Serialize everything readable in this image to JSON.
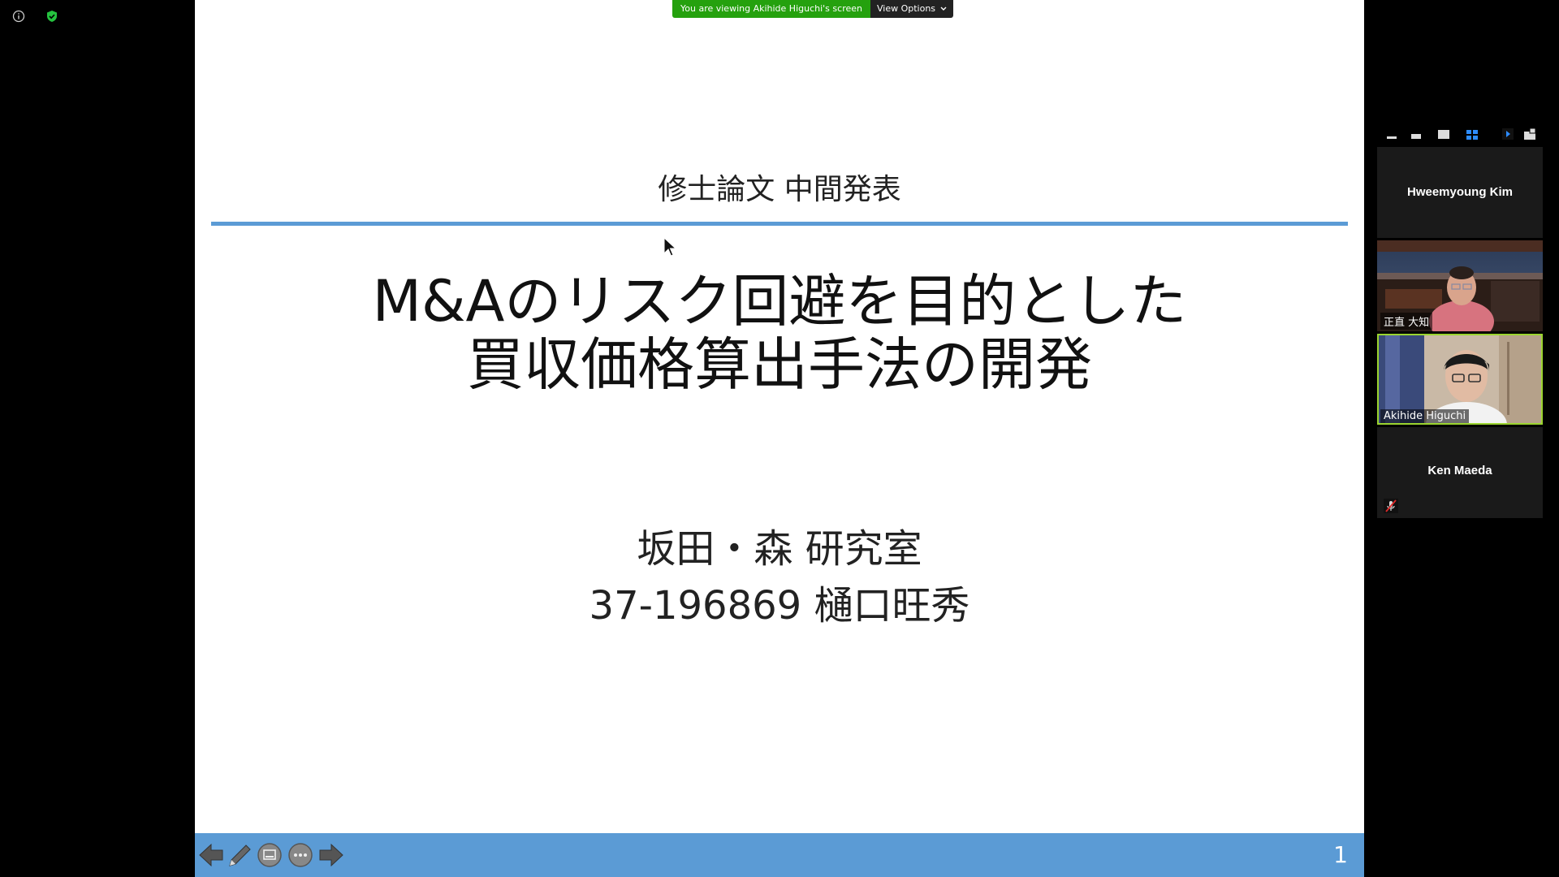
{
  "screen_share": {
    "banner_text": "You are viewing Akihide Higuchi's screen",
    "view_options_label": "View Options"
  },
  "slide": {
    "subtitle": "修士論文 中間発表",
    "title_line1": "M&Aのリスク回避を目的とした",
    "title_line2": "買収価格算出手法の開発",
    "lab": "坂田・森 研究室",
    "student": "37-196869 樋口旺秀",
    "page_number": "1"
  },
  "participants": [
    {
      "name": "Hweemyoung Kim",
      "video": false
    },
    {
      "name": "正直 大知",
      "video": true
    },
    {
      "name": "Akihide Higuchi",
      "video": true,
      "active": true
    },
    {
      "name": "Ken Maeda",
      "video": false,
      "muted": true
    }
  ],
  "colors": {
    "accent_blue": "#5b9bd5",
    "banner_green": "#25a10e",
    "active_outline": "#9bd42f"
  }
}
